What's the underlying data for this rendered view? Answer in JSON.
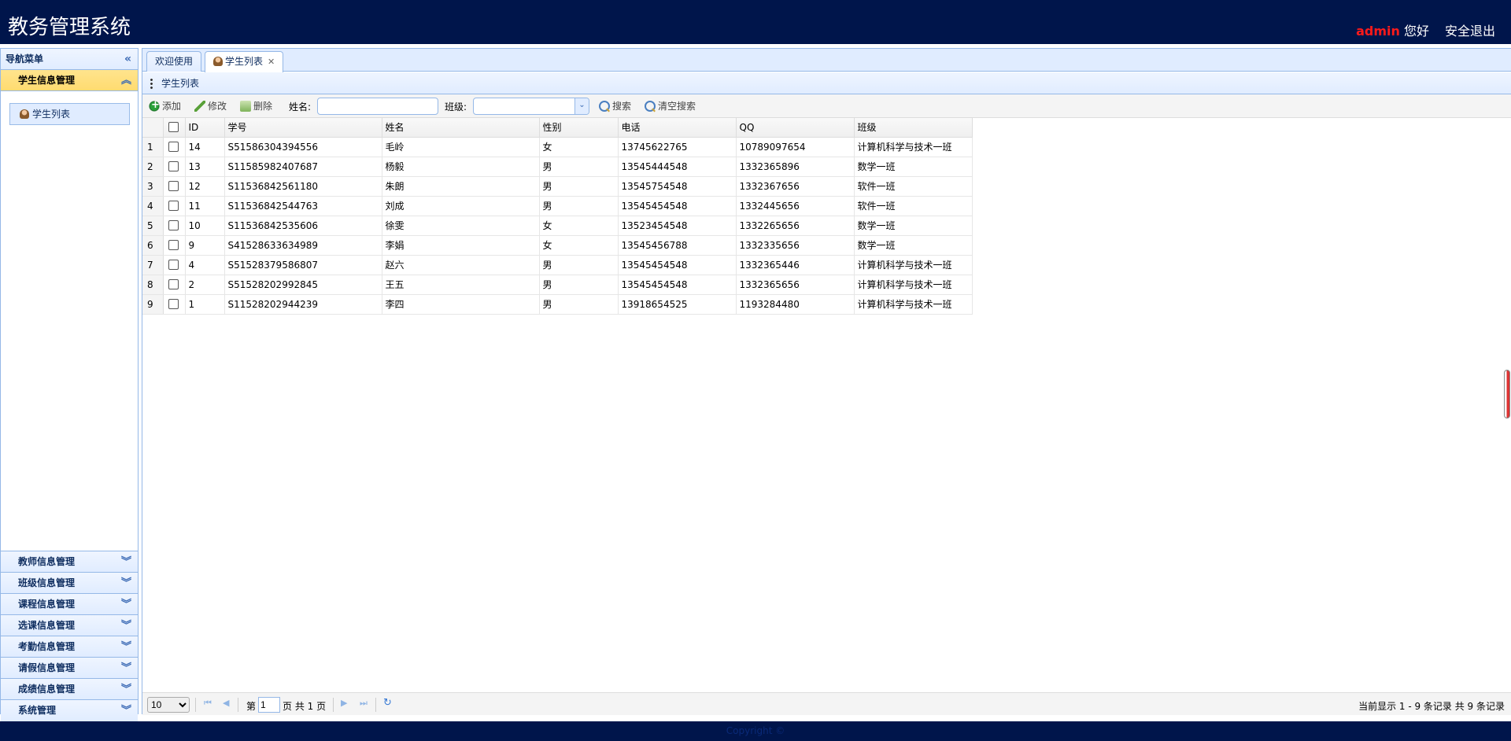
{
  "header": {
    "title": "教务管理系统",
    "user_name": "admin",
    "greeting": "您好",
    "logout": "安全退出"
  },
  "nav": {
    "title": "导航菜单",
    "active_group": "学生信息管理",
    "active_item": "学生列表",
    "groups": [
      "教师信息管理",
      "班级信息管理",
      "课程信息管理",
      "选课信息管理",
      "考勤信息管理",
      "请假信息管理",
      "成绩信息管理",
      "系统管理"
    ]
  },
  "tabs": [
    {
      "label": "欢迎使用"
    },
    {
      "label": "学生列表"
    }
  ],
  "panel": {
    "title": "学生列表"
  },
  "toolbar": {
    "add": "添加",
    "edit": "修改",
    "delete": "删除",
    "name_label": "姓名:",
    "name_value": "",
    "class_label": "班级:",
    "class_value": "",
    "search": "搜索",
    "clear_search": "清空搜索"
  },
  "grid": {
    "columns": [
      "ID",
      "学号",
      "姓名",
      "性别",
      "电话",
      "QQ",
      "班级"
    ],
    "rows": [
      [
        "1",
        "14",
        "S51586304394556",
        "毛岭",
        "女",
        "13745622765",
        "10789097654",
        "计算机科学与技术一班"
      ],
      [
        "2",
        "13",
        "S11585982407687",
        "杨毅",
        "男",
        "13545444548",
        "1332365896",
        "数学一班"
      ],
      [
        "3",
        "12",
        "S11536842561180",
        "朱朗",
        "男",
        "13545754548",
        "1332367656",
        "软件一班"
      ],
      [
        "4",
        "11",
        "S11536842544763",
        "刘成",
        "男",
        "13545454548",
        "1332445656",
        "软件一班"
      ],
      [
        "5",
        "10",
        "S11536842535606",
        "徐雯",
        "女",
        "13523454548",
        "1332265656",
        "数学一班"
      ],
      [
        "6",
        "9",
        "S41528633634989",
        "李娟",
        "女",
        "13545456788",
        "1332335656",
        "数学一班"
      ],
      [
        "7",
        "4",
        "S51528379586807",
        "赵六",
        "男",
        "13545454548",
        "1332365446",
        "计算机科学与技术一班"
      ],
      [
        "8",
        "2",
        "S51528202992845",
        "王五",
        "男",
        "13545454548",
        "1332365656",
        "计算机科学与技术一班"
      ],
      [
        "9",
        "1",
        "S11528202944239",
        "李四",
        "男",
        "13918654525",
        "1193284480",
        "计算机科学与技术一班"
      ]
    ]
  },
  "pager": {
    "page_size": "10",
    "page_prefix": "第",
    "current_page": "1",
    "page_mid": "页 共 1 页",
    "info": "当前显示 1 - 9 条记录 共 9 条记录"
  },
  "footer": {
    "text": "Copyright ©"
  },
  "colors": {
    "header_bg": "#00154b",
    "accent_active": "#ffe48d",
    "border": "#95b8e7",
    "user_name": "#ff1a1a"
  }
}
